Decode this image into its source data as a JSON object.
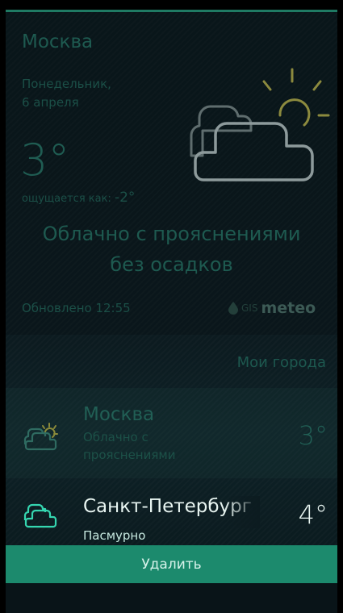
{
  "current": {
    "city": "Москва",
    "day": "Понедельник,",
    "date": "6 апреля",
    "temperature": "3°",
    "feels_like_label": "ощущается как:",
    "feels_like_value": "-2°",
    "condition_line1": "Облачно с прояснениями",
    "condition_line2": "без осадков",
    "updated": "Обновлено 12:55",
    "brand_gis": "GIS",
    "brand_meteo": "meteo",
    "icon": "partly-cloudy-icon"
  },
  "cities": {
    "header": "Мои города",
    "items": [
      {
        "name": "Москва",
        "condition": "Облачно с прояснениями",
        "temperature": "3°",
        "icon": "partly-cloudy-icon"
      },
      {
        "name": "Санкт-Петербург",
        "condition": "Пасмурно",
        "temperature": "4°",
        "icon": "overcast-icon"
      }
    ]
  },
  "context_menu": {
    "delete_label": "Удалить"
  },
  "colors": {
    "accent": "#1c8a6d",
    "sun": "#8a8a3a",
    "cloud_big": "#7a8a8c"
  }
}
